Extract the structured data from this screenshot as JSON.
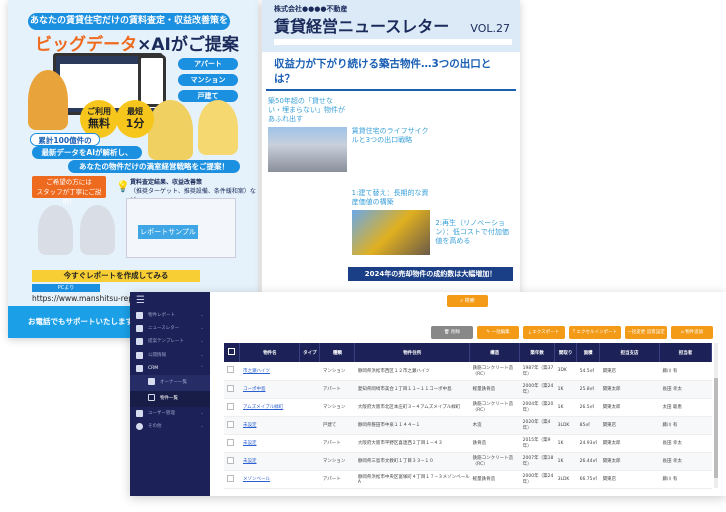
{
  "flyer": {
    "top_banner": "あなたの賃貸住宅だけの賃料査定・収益改善策を",
    "headline_a": "ビッグデータ",
    "headline_b": "×AIがご提案",
    "types": [
      "アパート",
      "マンション",
      "戸建て"
    ],
    "badge_free": [
      "ご利用",
      "無料"
    ],
    "badge_time": [
      "最短",
      "1分"
    ],
    "line1": "累計100億件の",
    "line2": "最新データをAIが解析し、",
    "line3": "あなたの物件だけの満室経営戦略をご提案！",
    "staff_note": [
      "ご希望の方には",
      "スタッフが丁寧にご説明！"
    ],
    "report_note": [
      "賃料査定結果、収益改善策",
      "（推奨ターゲット、推奨設備、条件緩和案）など"
    ],
    "sample_label": "レポートサンプル",
    "cta": "今すぐレポートを作成してみる",
    "pc_label": "PCより",
    "url": "https://www.manshitsu-report.",
    "footer": "お電話でもサポートいたします",
    "colors": {
      "blue": "#1b8fe0",
      "orange": "#ee6a1f",
      "yellow": "#f7cf35"
    }
  },
  "newsletter": {
    "company": "株式会社●●●●不動産",
    "title": "賃貸経営ニュースレター",
    "vol": "VOL.27",
    "headline": "収益力が下がり続ける築古物件…3つの出口とは？",
    "col1_heading": "築50年超の「貸せない・埋まらない」物件があふれ出す",
    "col2_heading": "賃貸住宅のライフサイクルと3つの出口戦略",
    "col2_heading2": "1:建て替え：長期的な資産価値の構築",
    "col3_heading": "2:再生（リノベーション）：低コストで付加価値を高める",
    "bottom_banner": "2024年の売却物件の成約数は大幅増加！"
  },
  "crm": {
    "sidebar": [
      {
        "label": "物件レポート",
        "icon": "report-icon"
      },
      {
        "label": "ニュースレター",
        "icon": "newsletter-icon"
      },
      {
        "label": "提案テンプレート",
        "icon": "template-icon"
      },
      {
        "label": "公開情報",
        "icon": "search-icon"
      },
      {
        "label": "CRM",
        "icon": "user-icon"
      },
      {
        "label": "オーナー一覧",
        "icon": "owner-icon"
      },
      {
        "label": "物件一覧",
        "icon": "building-icon"
      },
      {
        "label": "ユーザー管理",
        "icon": "users-icon"
      },
      {
        "label": "その他",
        "icon": "gear-icon"
      }
    ],
    "search_label": "検索",
    "toolbar": [
      "削除",
      "一括編集",
      "エクスポート",
      "エクセルインポート",
      "一括変更 追客設定",
      "物件追加"
    ],
    "columns": [
      "物件名",
      "タイプ",
      "種類",
      "物件住所",
      "構造",
      "築年数",
      "間取り",
      "面積",
      "担当支店",
      "担当者"
    ],
    "rows": [
      [
        "市之瀬ハイツ",
        "",
        "マンション",
        "静岡県浜松市西区１２市之瀬ハイツ",
        "鉄筋コンクリート造（RC）",
        "1987年（築37年）",
        "3DK",
        "54.5㎡",
        "関東店",
        "藤川 有"
      ],
      [
        "コーポ中島",
        "",
        "アパート",
        "愛知県岡崎市美合１丁目１１−１１コーポ中島",
        "軽量鉄骨造",
        "2000年（築24年）",
        "1K",
        "25.8㎡",
        "関東太郎",
        "長田 幸太"
      ],
      [
        "アムズメイプル緑町",
        "",
        "マンション",
        "大阪府大阪市北区本庄町３−４アムズメイプル緑町",
        "鉄筋コンクリート造（RC）",
        "2004年（築20年）",
        "1K",
        "26.5㎡",
        "関東太郎",
        "太田 聡恵"
      ],
      [
        "未設定",
        "",
        "戸建て",
        "静岡県磐田市中泉１１４４−１",
        "木造",
        "2020年（築4年）",
        "3LDK",
        "85㎡",
        "関東店",
        "藤川 有"
      ],
      [
        "未設定",
        "",
        "アパート",
        "大阪府大阪市平野区喜連西２丁目１−４３",
        "鉄骨造",
        "2015年（築9年）",
        "1K",
        "24.93㎡",
        "関東太郎",
        "長田 幸太"
      ],
      [
        "未設定",
        "",
        "マンション",
        "静岡県三島市文教町１丁目３３−１０",
        "鉄筋コンクリート造（RC）",
        "2007年（築18年）",
        "1K",
        "26.44㎡",
        "関東太郎",
        "長田 幸太"
      ],
      [
        "メゾンベール",
        "",
        "アパート",
        "静岡県浜松市中央区富塚町４丁目１７−３メゾンベールA",
        "軽量鉄骨造",
        "2000年（築24年）",
        "3LDK",
        "66.75㎡",
        "関東店",
        "藤川 有"
      ]
    ],
    "colors": {
      "navy": "#1c2257",
      "orange": "#f39a16"
    }
  }
}
